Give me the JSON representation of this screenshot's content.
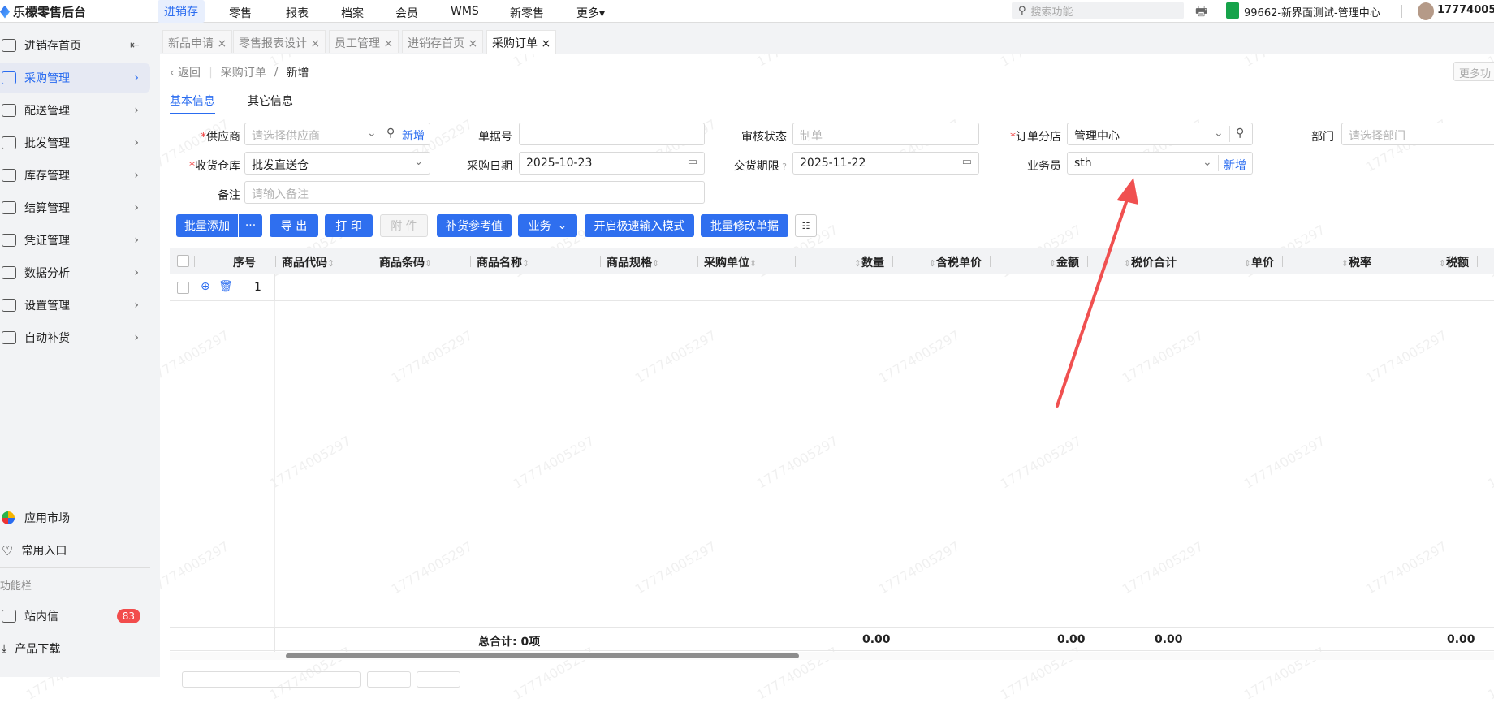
{
  "app": {
    "title": "乐檬零售后台"
  },
  "topnav": {
    "items": [
      "进销存",
      "零售",
      "报表",
      "档案",
      "会员",
      "WMS",
      "新零售",
      "更多▾"
    ],
    "active": 0,
    "search_placeholder": "搜索功能",
    "store": "99662-新界面测试-管理中心",
    "user": "17774005"
  },
  "sidebar": {
    "items": [
      {
        "label": "进销存首页",
        "icon": "home-icon"
      },
      {
        "label": "采购管理",
        "icon": "cart-icon"
      },
      {
        "label": "配送管理",
        "icon": "map-icon"
      },
      {
        "label": "批发管理",
        "icon": "server-icon"
      },
      {
        "label": "库存管理",
        "icon": "inbox-icon"
      },
      {
        "label": "结算管理",
        "icon": "dollar-icon"
      },
      {
        "label": "凭证管理",
        "icon": "document-icon"
      },
      {
        "label": "数据分析",
        "icon": "chart-icon"
      },
      {
        "label": "设置管理",
        "icon": "hexagon-icon"
      },
      {
        "label": "自动补货",
        "icon": "robot-icon"
      }
    ],
    "collapse_icon": "⇤",
    "bottom": {
      "app_market": "应用市场",
      "favorites": "常用入口",
      "section": "功能栏",
      "messages": "站内信",
      "messages_badge": "83",
      "download": "产品下载"
    }
  },
  "tabs": [
    {
      "label": "新品申请 ×"
    },
    {
      "label": "零售报表设计 ×"
    },
    {
      "label": "员工管理 ×"
    },
    {
      "label": "进销存首页 ×"
    },
    {
      "label": "采购订单 ×"
    }
  ],
  "breadcrumb": {
    "back": "返回",
    "parent": "采购订单",
    "sep": "/",
    "current": "新增"
  },
  "more_button": "更多功",
  "page_tabs": [
    "基本信息",
    "其它信息"
  ],
  "form": {
    "supplier": {
      "label": "供应商",
      "placeholder": "请选择供应商",
      "add": "新增"
    },
    "doc_no": {
      "label": "单据号",
      "value": ""
    },
    "audit_status": {
      "label": "审核状态",
      "placeholder": "制单"
    },
    "order_store": {
      "label": "订单分店",
      "value": "管理中心"
    },
    "department": {
      "label": "部门",
      "placeholder": "请选择部门"
    },
    "warehouse": {
      "label": "收货仓库",
      "value": "批发直送仓"
    },
    "purchase_date": {
      "label": "采购日期",
      "value": "2025-10-23"
    },
    "delivery_deadline": {
      "label": "交货期限",
      "value": "2025-11-22"
    },
    "salesperson": {
      "label": "业务员",
      "value": "sth",
      "add": "新增"
    },
    "remark": {
      "label": "备注",
      "placeholder": "请输入备注"
    }
  },
  "toolbar": {
    "batch_add": "批量添加",
    "more": "···",
    "export": "导 出",
    "print": "打 印",
    "attach": "附 件",
    "replenish": "补货参考值",
    "business": "业务",
    "fast_mode": "开启极速输入模式",
    "batch_edit": "批量修改单据"
  },
  "table": {
    "columns": [
      "序号",
      "商品代码",
      "商品条码",
      "商品名称",
      "商品规格",
      "采购单位",
      "数量",
      "含税单价",
      "金额",
      "税价合计",
      "单价",
      "税率",
      "税额"
    ],
    "rows": [
      {
        "index": "1"
      }
    ],
    "footer": {
      "label": "总合计: 0项",
      "qty": "0.00",
      "amount": "0.00",
      "total": "0.00",
      "tax": "0.00"
    }
  },
  "watermark": "17774005297",
  "annotation": {
    "color": "#f05050"
  }
}
